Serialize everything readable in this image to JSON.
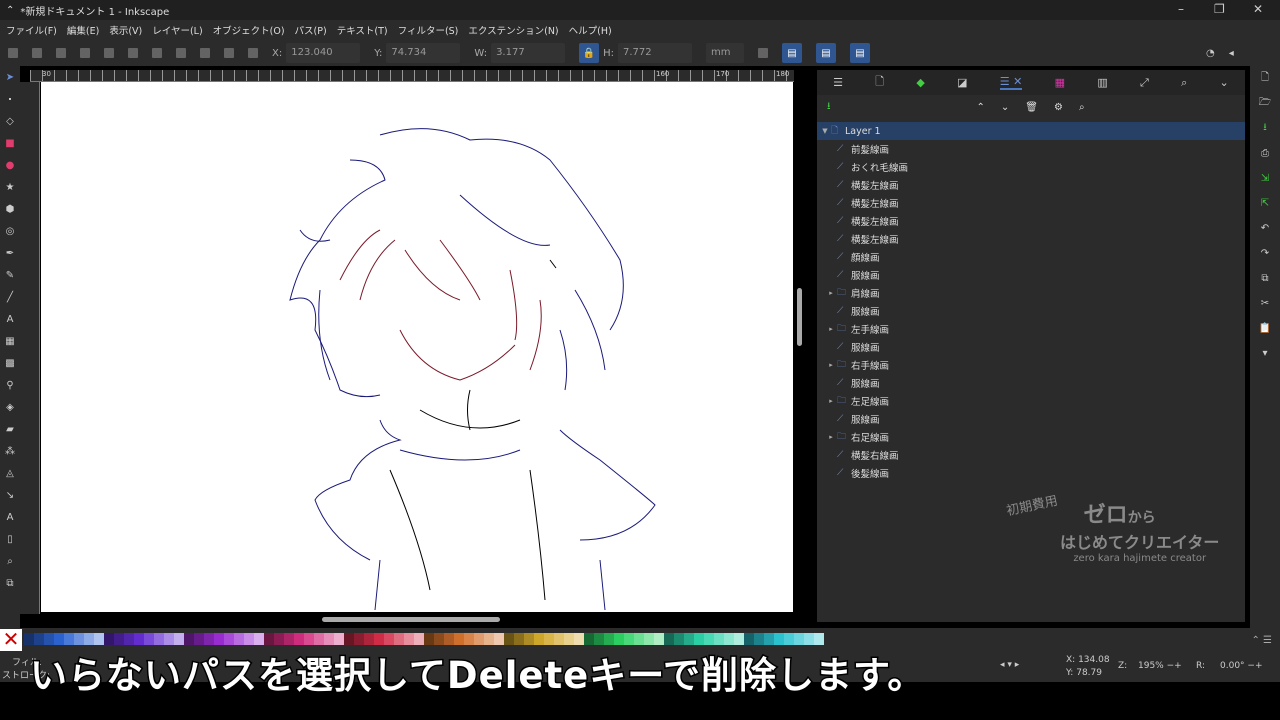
{
  "window": {
    "title": "*新規ドキュメント 1 - Inkscape"
  },
  "menu": [
    "ファイル(F)",
    "編集(E)",
    "表示(V)",
    "レイヤー(L)",
    "オブジェクト(O)",
    "パス(P)",
    "テキスト(T)",
    "フィルター(S)",
    "エクステンション(N)",
    "ヘルプ(H)"
  ],
  "toolbar": {
    "x_label": "X:",
    "x": "123.040",
    "y_label": "Y:",
    "y": "74.734",
    "w_label": "W:",
    "w": "3.177",
    "h_label": "H:",
    "h": "7.772",
    "unit": "mm"
  },
  "ruler": {
    "ticks": [
      "30",
      "160",
      "170",
      "180"
    ]
  },
  "layers": {
    "root": "Layer 1",
    "items": [
      {
        "label": "前髪線画",
        "type": "path"
      },
      {
        "label": "おくれ毛線画",
        "type": "path"
      },
      {
        "label": "横髪左線画",
        "type": "path"
      },
      {
        "label": "横髪左線画",
        "type": "path"
      },
      {
        "label": "横髪左線画",
        "type": "path"
      },
      {
        "label": "横髪左線画",
        "type": "path"
      },
      {
        "label": "顔線画",
        "type": "path"
      },
      {
        "label": "服線画",
        "type": "path"
      },
      {
        "label": "肩線画",
        "type": "group"
      },
      {
        "label": "服線画",
        "type": "path"
      },
      {
        "label": "左手線画",
        "type": "group"
      },
      {
        "label": "服線画",
        "type": "path"
      },
      {
        "label": "右手線画",
        "type": "group"
      },
      {
        "label": "服線画",
        "type": "path"
      },
      {
        "label": "左足線画",
        "type": "group"
      },
      {
        "label": "服線画",
        "type": "path"
      },
      {
        "label": "右足線画",
        "type": "group"
      },
      {
        "label": "横髪右線画",
        "type": "path"
      },
      {
        "label": "後髪線画",
        "type": "path"
      }
    ]
  },
  "status": {
    "fill_label": "フィル:",
    "stroke_label": "ストローク:",
    "cx_label": "X:",
    "cx": "134.08",
    "cy_label": "Y:",
    "cy": "78.79",
    "zoom_label": "Z:",
    "zoom": "195%",
    "rot_label": "R:",
    "rot": "0.00°"
  },
  "subtitle": "いらないパスを選択してDeleteキーで削除します。",
  "watermark": {
    "line1": "初期費用",
    "line2": "ゼロから",
    "line3": "はじめてクリエイター",
    "line4": "zero kara hajimete creator"
  },
  "colors": {
    "accent": "#2f5691",
    "selection": "#274066",
    "line_blue": "#1a1a7a",
    "line_red": "#7a1a2a"
  }
}
